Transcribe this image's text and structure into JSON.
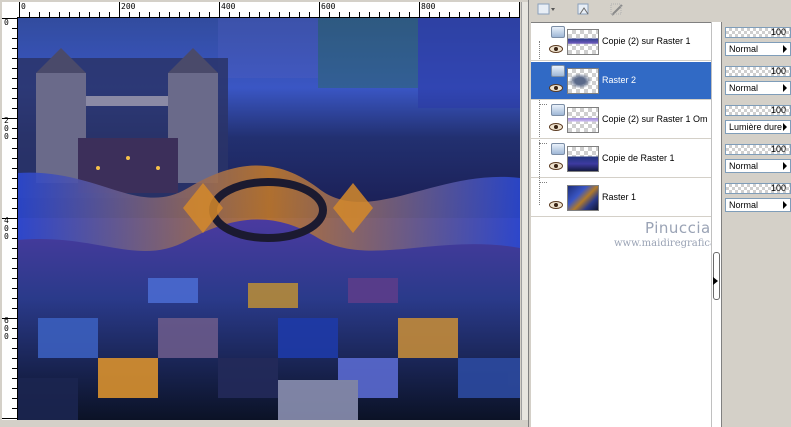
{
  "rulers": {
    "top_labels": [
      "0",
      "200",
      "400",
      "600",
      "800"
    ],
    "left_labels": [
      "0",
      "200",
      "400",
      "600"
    ]
  },
  "layers": [
    {
      "name": "Copie (2) sur Raster 1",
      "opacity": "100",
      "blend": "Normal",
      "selected": false
    },
    {
      "name": "Raster 2",
      "opacity": "100",
      "blend": "Normal",
      "selected": true
    },
    {
      "name": "Copie (2) sur Raster 1 Om",
      "opacity": "100",
      "blend": "Lumière dure",
      "selected": false
    },
    {
      "name": "Copie de Raster 1",
      "opacity": "100",
      "blend": "Normal",
      "selected": false
    },
    {
      "name": "Raster 1",
      "opacity": "100",
      "blend": "Normal",
      "selected": false
    }
  ],
  "watermark": {
    "line1": "Pinuccia",
    "line2": "www.maidiregrafica.eu"
  }
}
